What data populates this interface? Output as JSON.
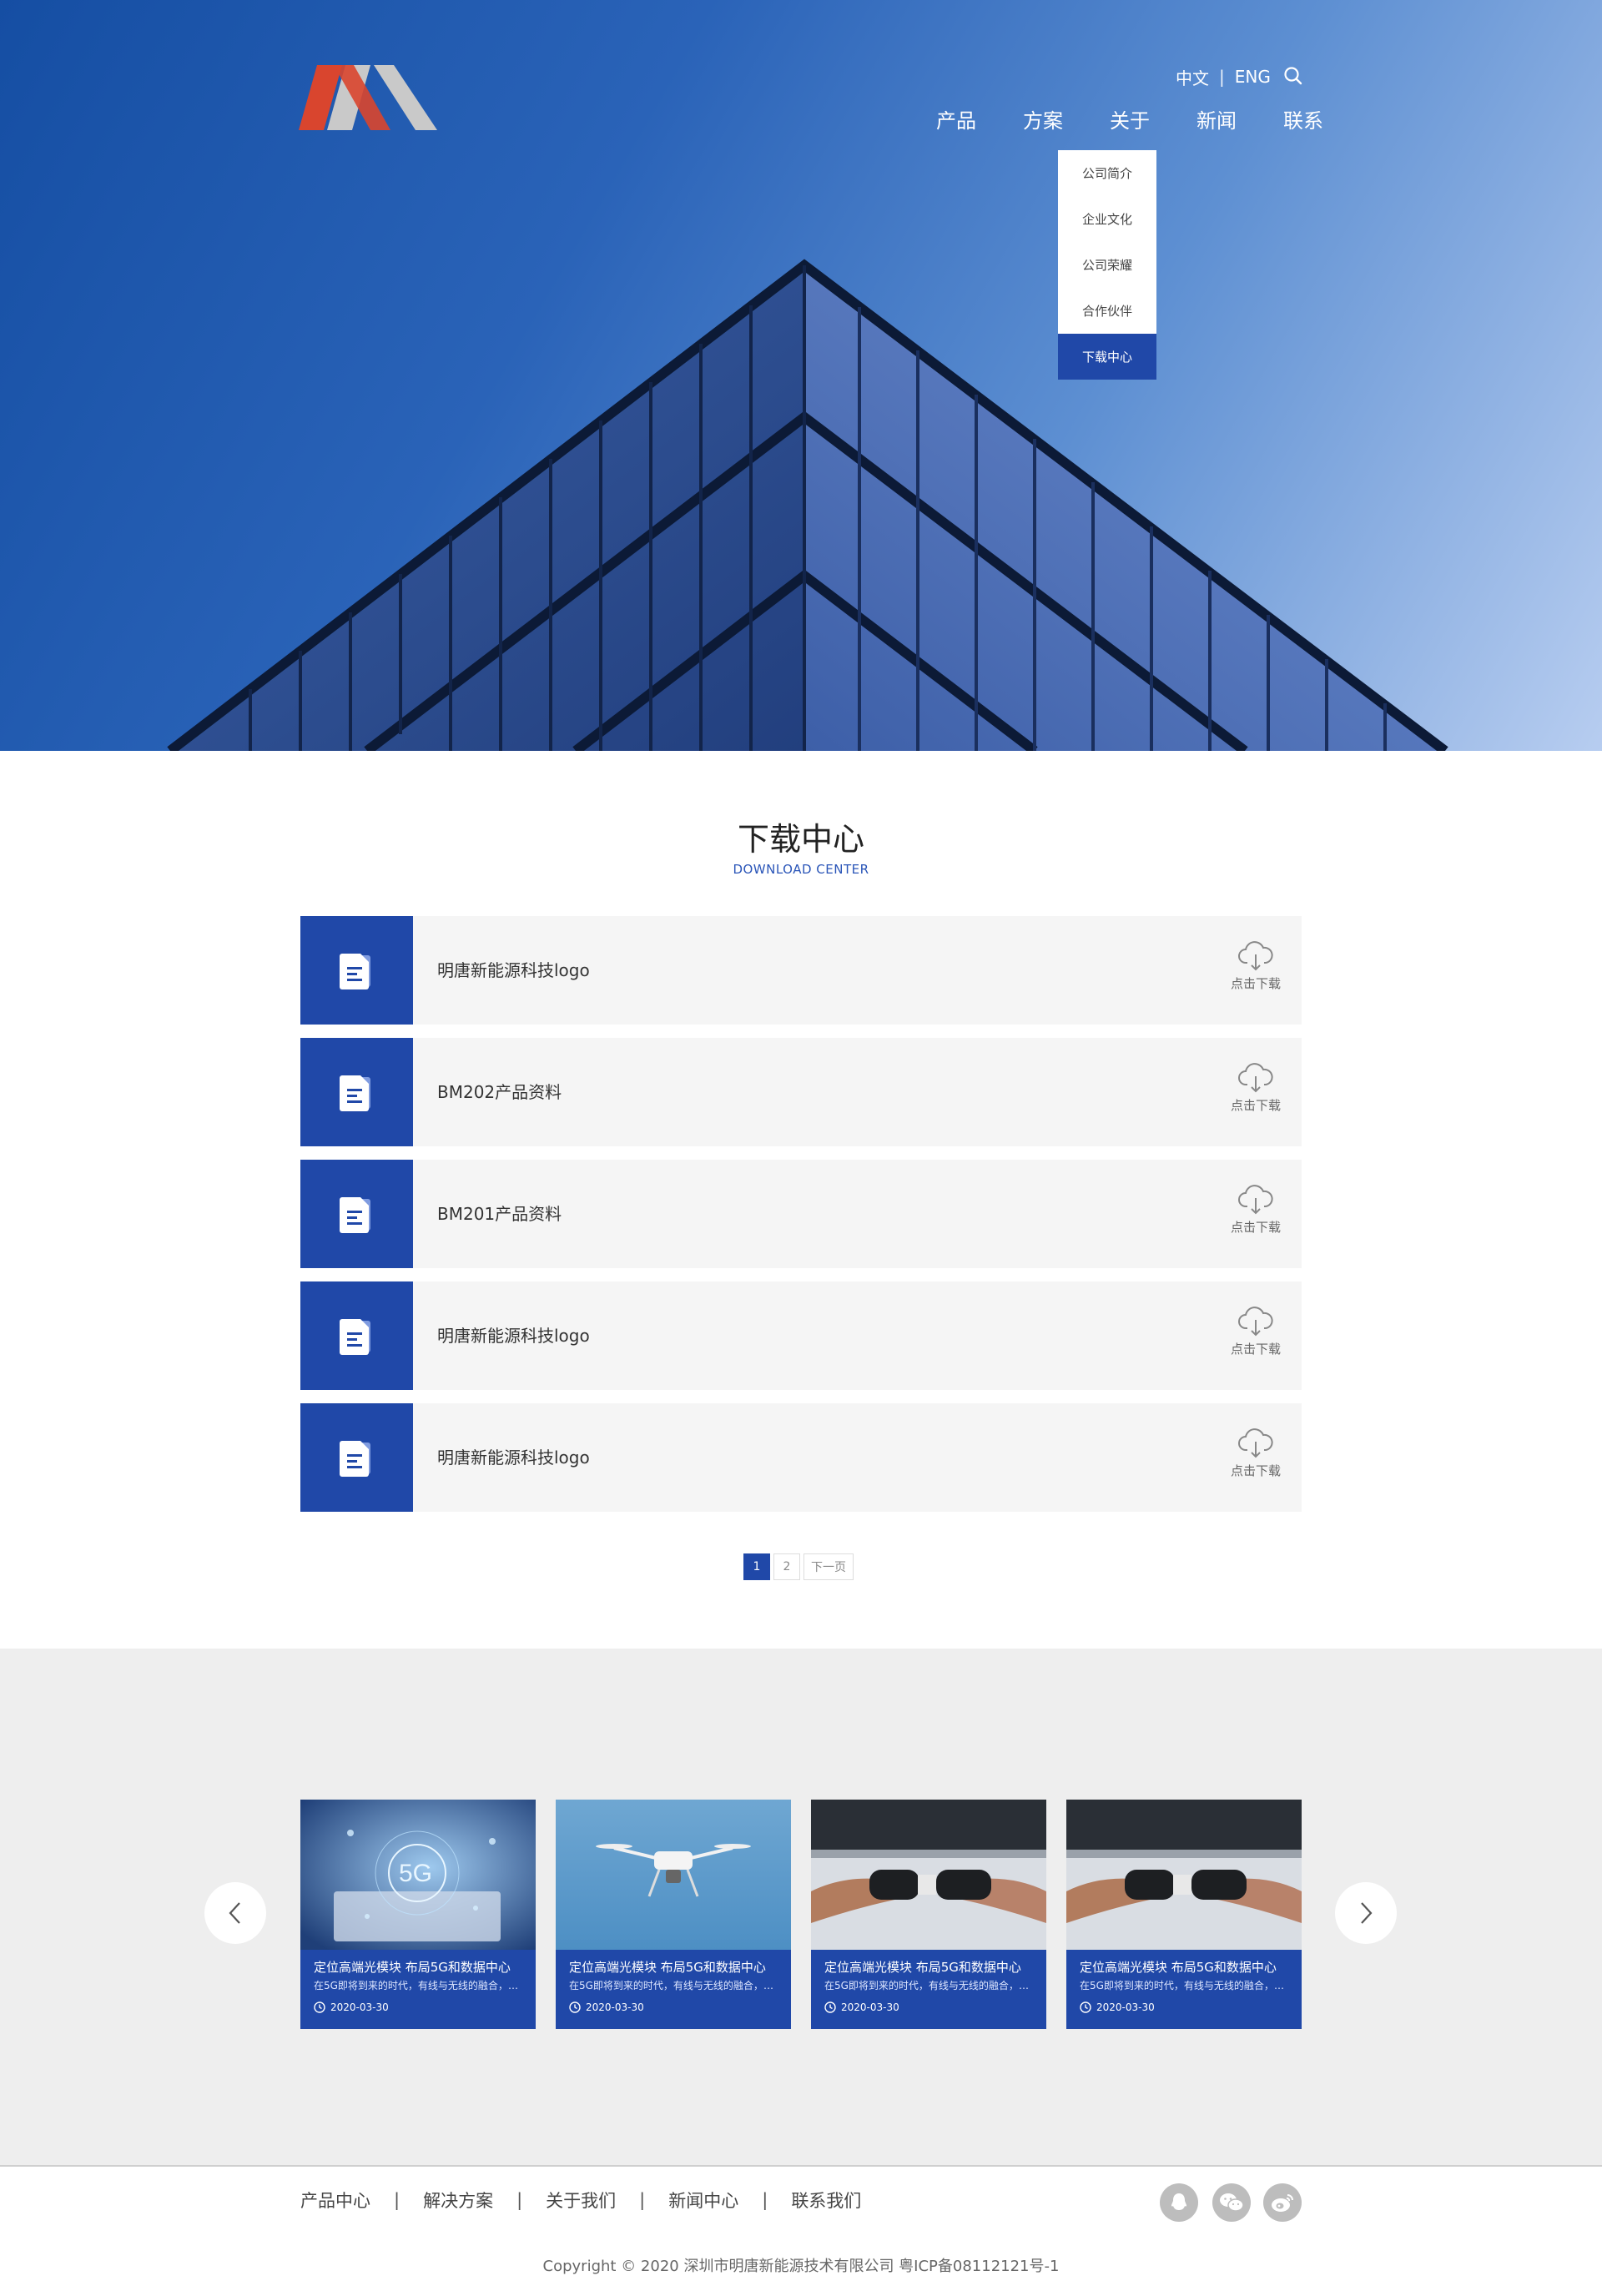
{
  "header": {
    "lang_cn": "中文",
    "lang_sep": "|",
    "lang_en": "ENG",
    "nav": [
      "产品",
      "方案",
      "关于",
      "新闻",
      "联系"
    ],
    "dropdown": [
      "公司简介",
      "企业文化",
      "公司荣耀",
      "合作伙伴",
      "下载中心"
    ],
    "dropdown_active_index": 4
  },
  "section": {
    "title": "下载中心",
    "subtitle": "DOWNLOAD CENTER"
  },
  "downloads": [
    {
      "title": "明唐新能源科技logo",
      "action": "点击下载"
    },
    {
      "title": "BM202产品资料",
      "action": "点击下载"
    },
    {
      "title": "BM201产品资料",
      "action": "点击下载"
    },
    {
      "title": "明唐新能源科技logo",
      "action": "点击下载"
    },
    {
      "title": "明唐新能源科技logo",
      "action": "点击下载"
    }
  ],
  "pagination": {
    "pages": [
      "1",
      "2"
    ],
    "current": "1",
    "next": "下一页"
  },
  "news": [
    {
      "title": "定位高端光模块 布局5G和数据中心",
      "desc": "在5G即将到来的时代，有线与无线的融合，已...",
      "date": "2020-03-30",
      "image": "5g-tech"
    },
    {
      "title": "定位高端光模块 布局5G和数据中心",
      "desc": "在5G即将到来的时代，有线与无线的融合，已...",
      "date": "2020-03-30",
      "image": "drone"
    },
    {
      "title": "定位高端光模块 布局5G和数据中心",
      "desc": "在5G即将到来的时代，有线与无线的融合，已...",
      "date": "2020-03-30",
      "image": "connector"
    },
    {
      "title": "定位高端光模块 布局5G和数据中心",
      "desc": "在5G即将到来的时代，有线与无线的融合，已...",
      "date": "2020-03-30",
      "image": "connector"
    }
  ],
  "footer": {
    "links": [
      "产品中心",
      "解决方案",
      "关于我们",
      "新闻中心",
      "联系我们"
    ],
    "separator": "|",
    "social": [
      "qq-icon",
      "wechat-icon",
      "weibo-icon"
    ],
    "copyright": "Copyright © 2020  深圳市明唐新能源技术有限公司  粤ICP备08112121号-1"
  },
  "colors": {
    "brand_blue": "#2048a8",
    "logo_red": "#d9452e",
    "logo_gray": "#c9c9c9",
    "news_bg": "#eeeeee"
  }
}
